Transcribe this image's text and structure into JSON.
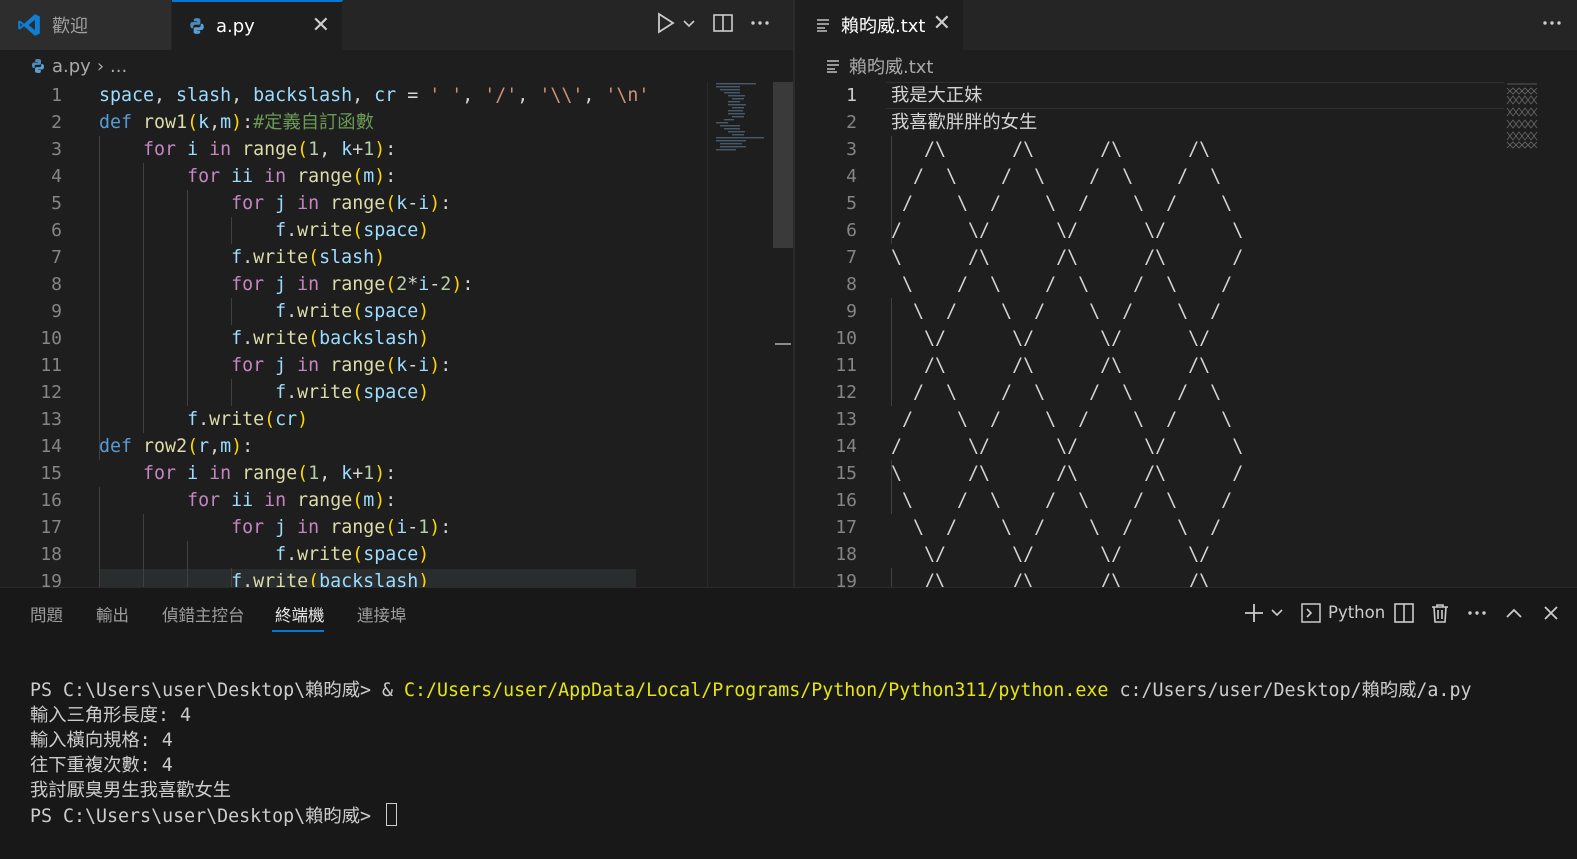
{
  "left_tabs": [
    {
      "label": "歡迎",
      "icon": "vscode-logo-icon"
    },
    {
      "label": "a.py",
      "icon": "python-icon",
      "close": "✕"
    }
  ],
  "left_breadcrumb": {
    "file": "a.py",
    "ellipsis": "..."
  },
  "right_tabs": [
    {
      "label": "賴昀威.txt",
      "icon": "text-file-icon",
      "close": "✕"
    }
  ],
  "right_breadcrumb": {
    "file": "賴昀威.txt"
  },
  "code_lines": [
    "space, slash, backslash, cr = ' ', '/', '\\\\', '\\n'",
    "def row1(k,m):#定義自訂函數",
    "    for i in range(1, k+1):",
    "        for ii in range(m):",
    "            for j in range(k-i):",
    "                f.write(space)",
    "            f.write(slash)",
    "            for j in range(2*i-2):",
    "                f.write(space)",
    "            f.write(backslash)",
    "            for j in range(k-i):",
    "                f.write(space)",
    "        f.write(cr)",
    "def row2(r,m):",
    "    for i in range(1, k+1):",
    "        for ii in range(m):",
    "            for j in range(i-1):",
    "                f.write(space)",
    "            f.write(backslash)"
  ],
  "text_lines": [
    "我是大正妹",
    "我喜歡胖胖的女生",
    "   /\\      /\\      /\\      /\\",
    "  /  \\    /  \\    /  \\    /  \\",
    " /    \\  /    \\  /    \\  /    \\",
    "/      \\/      \\/      \\/      \\",
    "\\      /\\      /\\      /\\      /",
    " \\    /  \\    /  \\    /  \\    /",
    "  \\  /    \\  /    \\  /    \\  /",
    "   \\/      \\/      \\/      \\/",
    "   /\\      /\\      /\\      /\\",
    "  /  \\    /  \\    /  \\    /  \\",
    " /    \\  /    \\  /    \\  /    \\",
    "/      \\/      \\/      \\/      \\",
    "\\      /\\      /\\      /\\      /",
    " \\    /  \\    /  \\    /  \\    /",
    "  \\  /    \\  /    \\  /    \\  /",
    "   \\/      \\/      \\/      \\/",
    "   /\\      /\\      /\\      /\\"
  ],
  "panel": {
    "tabs": [
      "問題",
      "輸出",
      "偵錯主控台",
      "終端機",
      "連接埠"
    ],
    "active_tab": "終端機",
    "shell_label": "Python"
  },
  "terminal": {
    "prompt": "PS C:\\Users\\user\\Desktop\\賴昀威> ",
    "command_amp": "& ",
    "command_exe": "C:/Users/user/AppData/Local/Programs/Python/Python311/python.exe",
    "command_arg": " c:/Users/user/Desktop/賴昀威/a.py",
    "output": [
      "輸入三角形長度: 4",
      "輸入橫向規格: 4",
      "往下重複次數: 4",
      "我討厭臭男生我喜歡女生"
    ]
  },
  "colors": {
    "accent": "#0078d4",
    "editor_bg": "#1e1e1e",
    "terminal_path": "#e5e510"
  }
}
